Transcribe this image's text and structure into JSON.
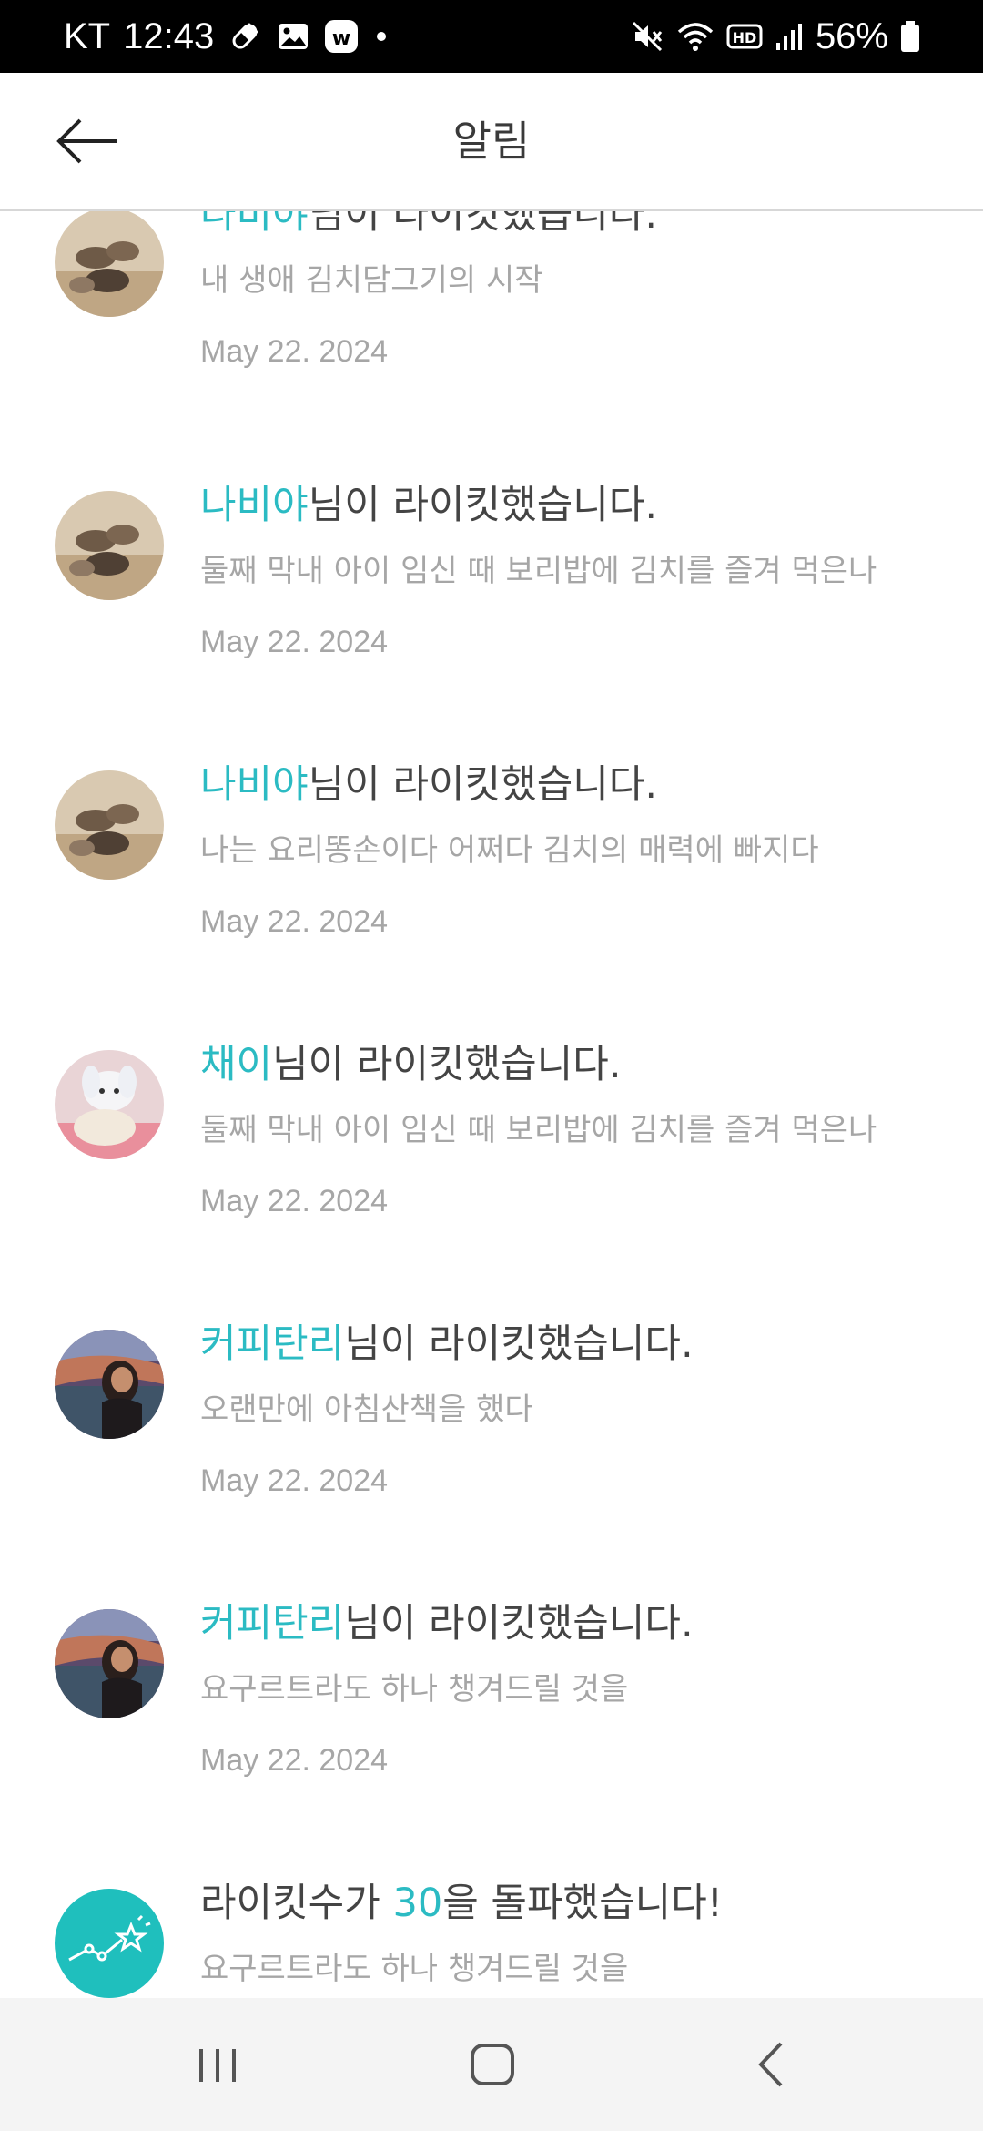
{
  "status_bar": {
    "carrier": "KT",
    "time": "12:43",
    "battery": "56%",
    "left_icons": [
      "pill-icon",
      "image-icon",
      "w-app-icon",
      "dot-icon"
    ],
    "right_icons": [
      "mute-icon",
      "wifi-icon",
      "hd-icon",
      "signal-icon",
      "battery-icon"
    ]
  },
  "header": {
    "title": "알림",
    "back_icon": "arrow-left-icon"
  },
  "notifications": [
    {
      "highlight": "나비야",
      "suffix": "님이 라이킷했습니다.",
      "subtitle": "내 생애 김치담그기의 시작",
      "date": "May 22. 2024",
      "avatar": "stones"
    },
    {
      "highlight": "나비야",
      "suffix": "님이 라이킷했습니다.",
      "subtitle": "둘째 막내 아이 임신 때 보리밥에 김치를 즐겨 먹은나",
      "date": "May 22. 2024",
      "avatar": "stones"
    },
    {
      "highlight": "나비야",
      "suffix": "님이 라이킷했습니다.",
      "subtitle": "나는 요리똥손이다 어쩌다 김치의 매력에 빠지다",
      "date": "May 22. 2024",
      "avatar": "stones"
    },
    {
      "highlight": "채이",
      "suffix": "님이 라이킷했습니다.",
      "subtitle": "둘째 막내 아이 임신 때 보리밥에 김치를 즐겨 먹은나",
      "date": "May 22. 2024",
      "avatar": "plush"
    },
    {
      "highlight": "커피탄리",
      "suffix": "님이 라이킷했습니다.",
      "subtitle": "오랜만에 아침산책을 했다",
      "date": "May 22. 2024",
      "avatar": "painting"
    },
    {
      "highlight": "커피탄리",
      "suffix": "님이 라이킷했습니다.",
      "subtitle": "요구르트라도 하나 챙겨드릴 것을",
      "date": "May 22. 2024",
      "avatar": "painting"
    },
    {
      "prefix": "라이킷수가 ",
      "highlight": "30",
      "suffix": "을 돌파했습니다!",
      "subtitle": "요구르트라도 하나 챙겨드릴 것을",
      "date": "",
      "avatar": "milestone"
    }
  ],
  "nav_bar": {
    "recents_icon": "recent-apps-icon",
    "home_icon": "home-icon",
    "back_icon": "back-chevron-icon"
  },
  "colors": {
    "accent": "#2bbbc3",
    "title_text": "#444444",
    "secondary_text": "#a6a6a6"
  }
}
